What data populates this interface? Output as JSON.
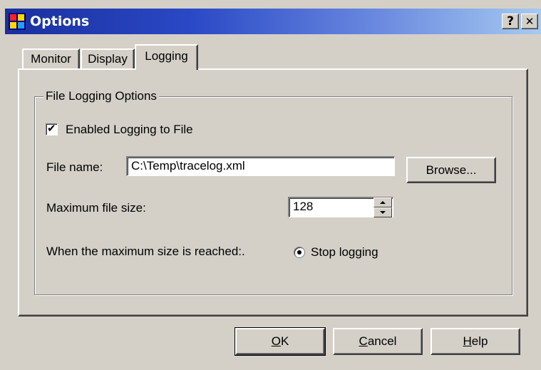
{
  "window": {
    "title": "Options",
    "help_glyph": "?",
    "close_glyph": "✕",
    "app_icon": "options-app-icon"
  },
  "tabs": [
    {
      "label": "Monitor"
    },
    {
      "label": "Display"
    },
    {
      "label": "Logging",
      "selected": true
    }
  ],
  "group": {
    "legend": "File Logging Options",
    "enable_logging": {
      "label": "Enabled Logging to File",
      "checked": true,
      "check_glyph": "✔"
    },
    "file_name": {
      "label": "File name:",
      "value": "C:\\Temp\\tracelog.xml"
    },
    "browse_label": "Browse...",
    "max_size": {
      "label": "Maximum file size:",
      "value": "128"
    },
    "when_reached": {
      "label": "When the maximum size is reached:."
    },
    "stop_logging": {
      "label": "Stop logging",
      "selected": true
    }
  },
  "buttons": {
    "ok": {
      "mnemonic": "O",
      "rest": "K"
    },
    "cancel": {
      "mnemonic": "C",
      "rest": "ancel"
    },
    "help": {
      "mnemonic": "H",
      "rest": "elp"
    }
  },
  "colors": {
    "title_gradient_start": "#1a2f9e",
    "title_gradient_end": "#a6caf0",
    "face": "#d4d0c8"
  }
}
